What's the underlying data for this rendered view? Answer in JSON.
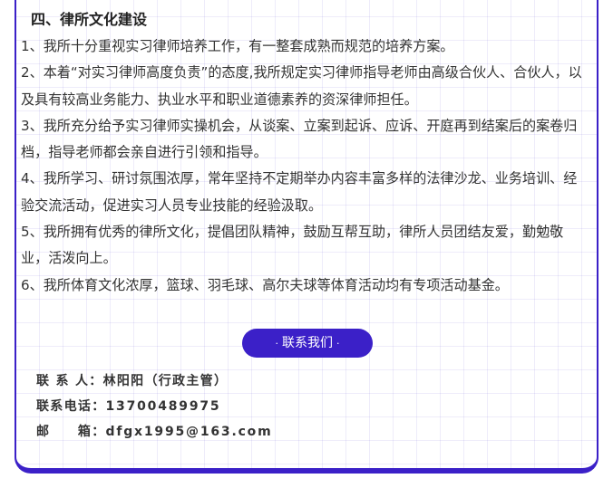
{
  "section": {
    "title": "四、律所文化建设",
    "paragraphs": [
      "1、我所十分重视实习律师培养工作，有一整套成熟而规范的培养方案。",
      "2、本着“对实习律师高度负责”的态度,我所规定实习律师指导老师由高级合伙人、合伙人，以及具有较高业务能力、执业水平和职业道德素养的资深律师担任。",
      "3、我所充分给予实习律师实操机会，从谈案、立案到起诉、应诉、开庭再到结案后的案卷归档，指导老师都会亲自进行引领和指导。",
      "4、我所学习、研讨氛围浓厚，常年坚持不定期举办内容丰富多样的法律沙龙、业务培训、经验交流活动，促进实习人员专业技能的经验汲取。",
      "5、我所拥有优秀的律所文化，提倡团队精神，鼓励互帮互助，律所人员团结友爱，勤勉敬业，活泼向上。",
      "6、我所体育文化浓厚，篮球、羽毛球、高尔夫球等体育活动均有专项活动基金。"
    ]
  },
  "contact": {
    "button_label": "联系我们",
    "button_dot": "·",
    "person_label": "联 系 人：",
    "person_value": "林阳阳（行政主管）",
    "phone_label": "联系电话：",
    "phone_value": "13700489975",
    "email_label": "邮　　箱：",
    "email_value": "dfgx1995@163.com"
  },
  "colors": {
    "accent": "#3b20c8",
    "grid": "#e3e0f6"
  }
}
